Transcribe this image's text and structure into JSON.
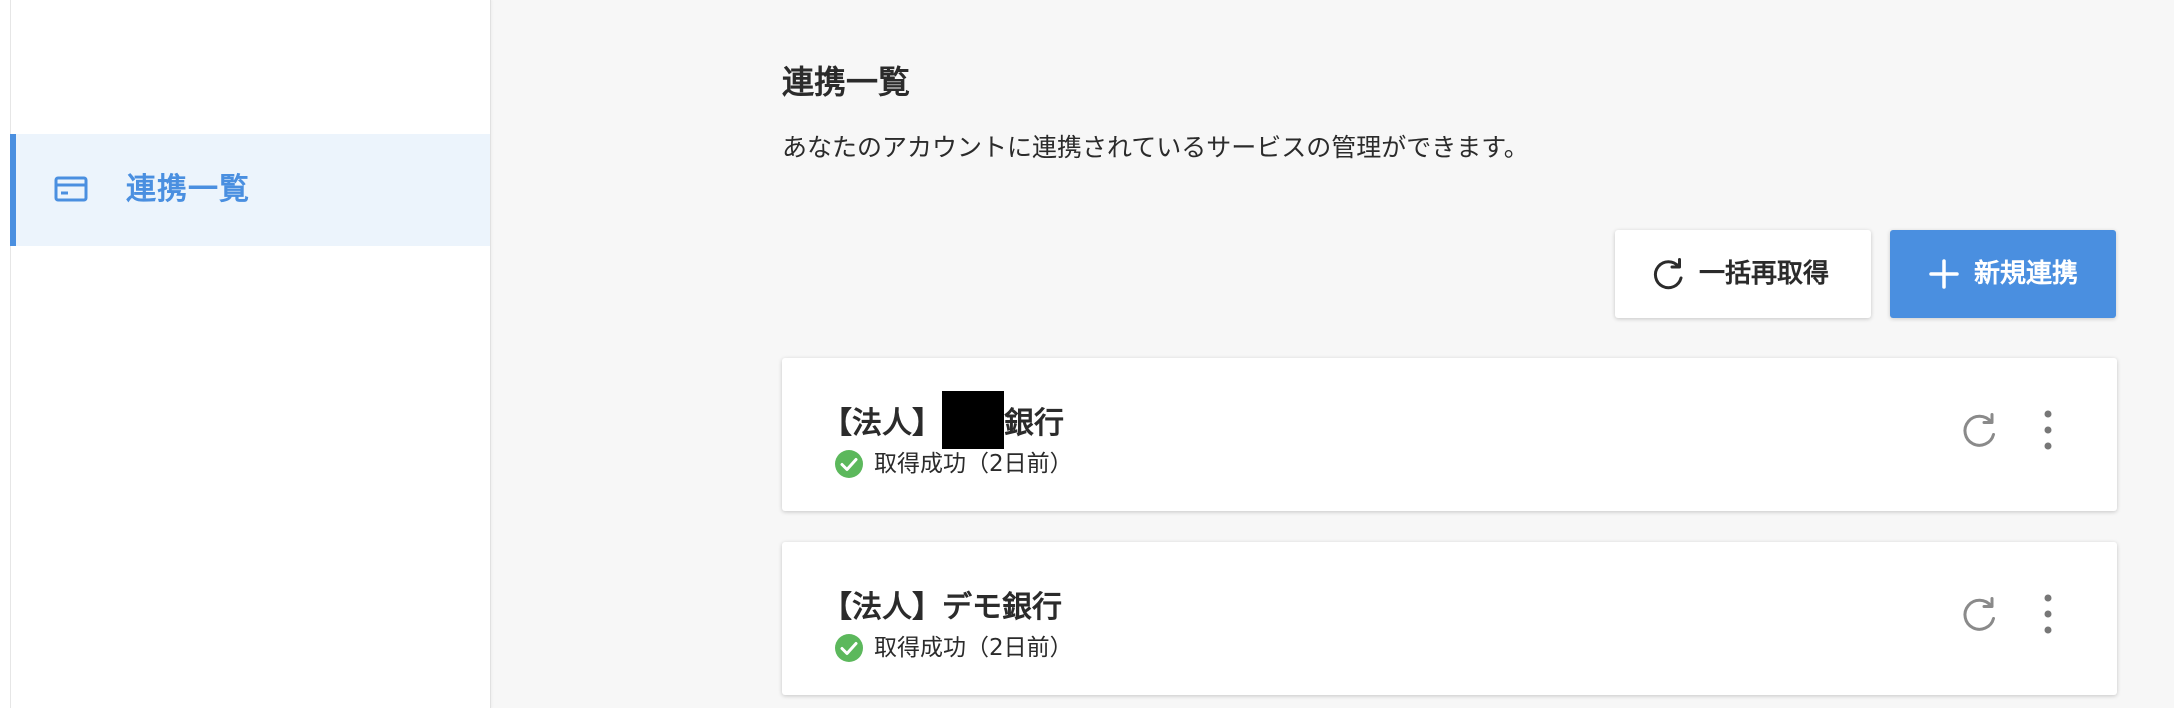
{
  "sidebar": {
    "items": [
      {
        "label": "連携一覧",
        "icon": "card-icon",
        "active": true
      }
    ],
    "accent_color": "#4a8fe0",
    "active_bg": "#ecf4fc"
  },
  "main": {
    "title": "連携一覧",
    "description": "あなたのアカウントに連携されているサービスの管理ができます。",
    "actions": {
      "refresh_all_label": "一括再取得",
      "refresh_all_icon": "refresh-icon",
      "new_label": "新規連携",
      "new_icon": "plus-icon",
      "new_bg": "#4a8fe0"
    },
    "connections": [
      {
        "title_prefix": "【法人】",
        "title_suffix": "銀行",
        "redacted": true,
        "status": "取得成功（2日前）",
        "status_icon": "check-circle-icon",
        "status_color": "#5cb85c"
      },
      {
        "title": "【法人】デモ銀行",
        "status": "取得成功（2日前）",
        "status_icon": "check-circle-icon",
        "status_color": "#5cb85c"
      }
    ]
  }
}
